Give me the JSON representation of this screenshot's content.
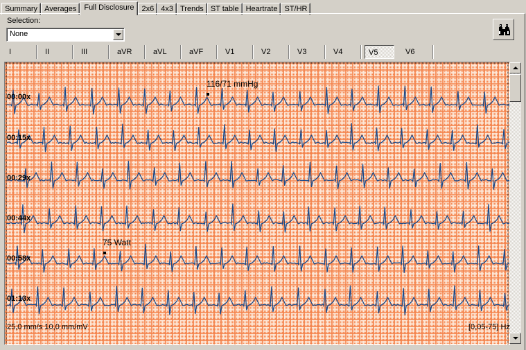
{
  "tabs": [
    {
      "label": "Summary",
      "active": false
    },
    {
      "label": "Averages",
      "active": false
    },
    {
      "label": "Full Disclosure",
      "active": true
    },
    {
      "label": "2x6",
      "active": false
    },
    {
      "label": "4x3",
      "active": false
    },
    {
      "label": "Trends",
      "active": false
    },
    {
      "label": "ST table",
      "active": false
    },
    {
      "label": "Heartrate",
      "active": false
    },
    {
      "label": "ST/HR",
      "active": false
    }
  ],
  "selection": {
    "label": "Selection:",
    "value": "None"
  },
  "find_button": {
    "icon": "binoculars-icon"
  },
  "leads": [
    "I",
    "II",
    "III",
    "aVR",
    "aVL",
    "aVF",
    "V1",
    "V2",
    "V3",
    "V4",
    "V5",
    "V6"
  ],
  "active_lead": "V5",
  "strips": [
    {
      "time": "00:00x"
    },
    {
      "time": "00:15x"
    },
    {
      "time": "00:29x"
    },
    {
      "time": "00:44x"
    },
    {
      "time": "00:58x"
    },
    {
      "time": "01:13x"
    }
  ],
  "annotations": [
    {
      "text": "116/71 mmHg",
      "strip": 0
    },
    {
      "text": "75 Watt",
      "strip": 4
    }
  ],
  "footer": {
    "scale": "25,0 mm/s 10,0 mm/mV",
    "filter": "[0,05-75] Hz"
  },
  "colors": {
    "grid_major": "#f4824a",
    "grid_minor": "#f4824a",
    "paper": "#fde8d8",
    "trace": "#1a4a8a"
  }
}
